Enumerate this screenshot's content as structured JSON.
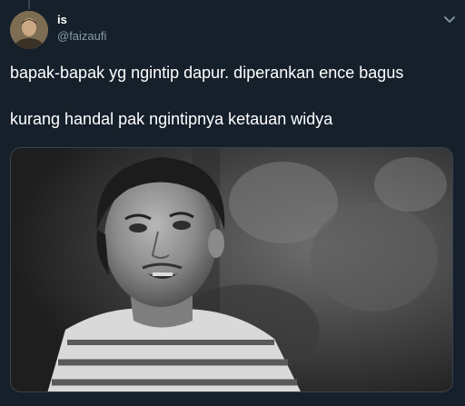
{
  "tweet": {
    "display_name": "is",
    "handle": "@faizaufi",
    "text_line1": "bapak-bapak yg ngintip dapur. diperankan ence bagus",
    "text_line2": "kurang handal pak ngintipnya ketauan widya"
  },
  "icons": {
    "menu": "chevron-down-icon"
  },
  "colors": {
    "background": "#15202b",
    "primary_text": "#ffffff",
    "secondary_text": "#8899a6",
    "border": "#38444d"
  }
}
